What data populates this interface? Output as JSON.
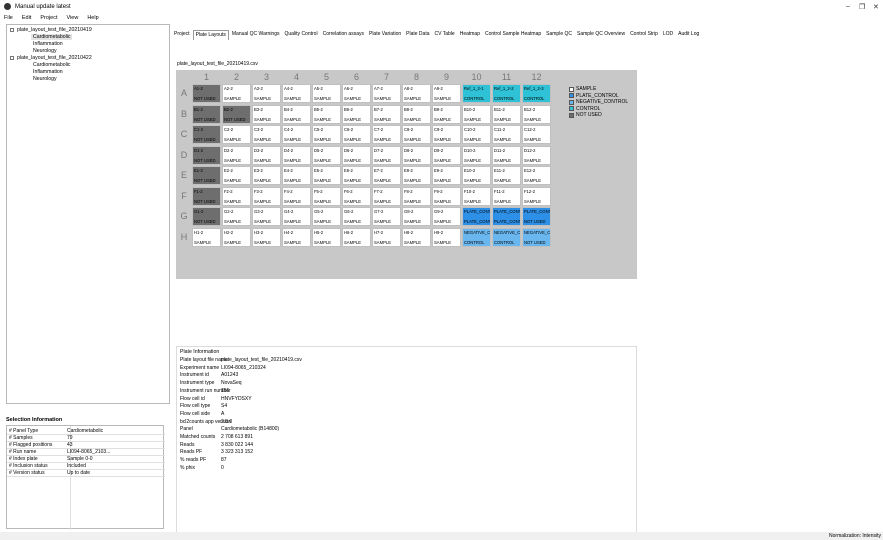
{
  "window": {
    "title": "Manual update latest",
    "minimize": "–",
    "maximize": "❐",
    "close": "✕"
  },
  "menu": [
    "File",
    "Edit",
    "Project",
    "View",
    "Help"
  ],
  "tree": [
    {
      "label": "plate_layout_test_file_20210419",
      "children": [
        "Cardiometabolic",
        "Inflammation",
        "Neurology"
      ]
    },
    {
      "label": "plate_layout_test_file_20210422",
      "children": [
        "Cardiometabolic",
        "Inflammation",
        "Neurology"
      ]
    }
  ],
  "selection": {
    "header": "Selection Information",
    "rows": [
      {
        "k": "# Panel Type",
        "v": "Cardiometabolic"
      },
      {
        "k": "# Samples",
        "v": "79"
      },
      {
        "k": "# Flagged positions",
        "v": "43"
      },
      {
        "k": "# Run name",
        "v": "LI094-8065_2103..."
      },
      {
        "k": "# Index plate",
        "v": "Sample 0-0"
      },
      {
        "k": "# Inclusion status",
        "v": "Included"
      },
      {
        "k": "# Version status",
        "v": "Up to date"
      }
    ]
  },
  "tabs": [
    "Project",
    "Plate Layouts",
    "Manual QC Warnings",
    "Quality Control",
    "Correlation assays",
    "Plate Variation",
    "Plate Data",
    "CV Table",
    "Heatmap",
    "Control Sample Heatmap",
    "Sample QC",
    "Sample QC Overview",
    "Control Strip",
    "LOD",
    "Audit Log"
  ],
  "active_tab": "Plate Layouts",
  "file_label": "plate_layout_test_file_20210419.csv",
  "plate": {
    "cols": [
      "1",
      "2",
      "3",
      "4",
      "5",
      "6",
      "7",
      "8",
      "9",
      "10",
      "11",
      "12"
    ],
    "rows": [
      "A",
      "B",
      "C",
      "D",
      "E",
      "F",
      "G",
      "H"
    ],
    "wells": [
      [
        [
          "A1-2",
          "NOT USED",
          "nu"
        ],
        [
          "A2-2",
          "SAMPLE",
          ""
        ],
        [
          "A3-2",
          "SAMPLE",
          ""
        ],
        [
          "A4-2",
          "SAMPLE",
          ""
        ],
        [
          "A5-2",
          "SAMPLE",
          ""
        ],
        [
          "A6-2",
          "SAMPLE",
          ""
        ],
        [
          "A7-2",
          "SAMPLE",
          ""
        ],
        [
          "A8-2",
          "SAMPLE",
          ""
        ],
        [
          "A9-2",
          "SAMPLE",
          ""
        ],
        [
          "Ref_1_2-1",
          "CONTROL",
          "pc"
        ],
        [
          "Ref_1_2-2",
          "CONTROL",
          "pc"
        ],
        [
          "Ref_1_2-3",
          "CONTROL",
          "pc"
        ]
      ],
      [
        [
          "B1-2",
          "NOT USED",
          "nu"
        ],
        [
          "B2-2",
          "NOT USED",
          "nu"
        ],
        [
          "B3-2",
          "SAMPLE",
          ""
        ],
        [
          "B4-2",
          "SAMPLE",
          ""
        ],
        [
          "B5-2",
          "SAMPLE",
          ""
        ],
        [
          "B6-2",
          "SAMPLE",
          ""
        ],
        [
          "B7-2",
          "SAMPLE",
          ""
        ],
        [
          "B8-2",
          "SAMPLE",
          ""
        ],
        [
          "B9-2",
          "SAMPLE",
          ""
        ],
        [
          "B10-2",
          "SAMPLE",
          ""
        ],
        [
          "B11-2",
          "SAMPLE",
          ""
        ],
        [
          "B12-2",
          "SAMPLE",
          ""
        ]
      ],
      [
        [
          "C1-2",
          "NOT USED",
          "nu"
        ],
        [
          "C2-2",
          "SAMPLE",
          ""
        ],
        [
          "C3-2",
          "SAMPLE",
          ""
        ],
        [
          "C4-2",
          "SAMPLE",
          ""
        ],
        [
          "C5-2",
          "SAMPLE",
          ""
        ],
        [
          "C6-2",
          "SAMPLE",
          ""
        ],
        [
          "C7-2",
          "SAMPLE",
          ""
        ],
        [
          "C8-2",
          "SAMPLE",
          ""
        ],
        [
          "C9-2",
          "SAMPLE",
          ""
        ],
        [
          "C10-2",
          "SAMPLE",
          ""
        ],
        [
          "C11-2",
          "SAMPLE",
          ""
        ],
        [
          "C12-2",
          "SAMPLE",
          ""
        ]
      ],
      [
        [
          "D1-2",
          "NOT USED",
          "nu"
        ],
        [
          "D2-2",
          "SAMPLE",
          ""
        ],
        [
          "D3-2",
          "SAMPLE",
          ""
        ],
        [
          "D4-2",
          "SAMPLE",
          ""
        ],
        [
          "D5-2",
          "SAMPLE",
          ""
        ],
        [
          "D6-2",
          "SAMPLE",
          ""
        ],
        [
          "D7-2",
          "SAMPLE",
          ""
        ],
        [
          "D8-2",
          "SAMPLE",
          ""
        ],
        [
          "D9-2",
          "SAMPLE",
          ""
        ],
        [
          "D10-2",
          "SAMPLE",
          ""
        ],
        [
          "D11-2",
          "SAMPLE",
          ""
        ],
        [
          "D12-2",
          "SAMPLE",
          ""
        ]
      ],
      [
        [
          "E1-2",
          "NOT USED",
          "nu"
        ],
        [
          "E2-2",
          "SAMPLE",
          ""
        ],
        [
          "E3-2",
          "SAMPLE",
          ""
        ],
        [
          "E4-2",
          "SAMPLE",
          ""
        ],
        [
          "E5-2",
          "SAMPLE",
          ""
        ],
        [
          "E6-2",
          "SAMPLE",
          ""
        ],
        [
          "E7-2",
          "SAMPLE",
          ""
        ],
        [
          "E8-2",
          "SAMPLE",
          ""
        ],
        [
          "E9-2",
          "SAMPLE",
          ""
        ],
        [
          "E10-2",
          "SAMPLE",
          ""
        ],
        [
          "E11-2",
          "SAMPLE",
          ""
        ],
        [
          "E12-2",
          "SAMPLE",
          ""
        ]
      ],
      [
        [
          "F1-2",
          "NOT USED",
          "nu"
        ],
        [
          "F2-2",
          "SAMPLE",
          ""
        ],
        [
          "F3-2",
          "SAMPLE",
          ""
        ],
        [
          "F4-2",
          "SAMPLE",
          ""
        ],
        [
          "F5-2",
          "SAMPLE",
          ""
        ],
        [
          "F6-2",
          "SAMPLE",
          ""
        ],
        [
          "F7-2",
          "SAMPLE",
          ""
        ],
        [
          "F8-2",
          "SAMPLE",
          ""
        ],
        [
          "F9-2",
          "SAMPLE",
          ""
        ],
        [
          "F10-2",
          "SAMPLE",
          ""
        ],
        [
          "F11-2",
          "SAMPLE",
          ""
        ],
        [
          "F12-2",
          "SAMPLE",
          ""
        ]
      ],
      [
        [
          "G1-2",
          "NOT USED",
          "nu"
        ],
        [
          "G2-2",
          "SAMPLE",
          ""
        ],
        [
          "G3-2",
          "SAMPLE",
          ""
        ],
        [
          "G4-2",
          "SAMPLE",
          ""
        ],
        [
          "G5-2",
          "SAMPLE",
          ""
        ],
        [
          "G6-2",
          "SAMPLE",
          ""
        ],
        [
          "G7-2",
          "SAMPLE",
          ""
        ],
        [
          "G8-2",
          "SAMPLE",
          ""
        ],
        [
          "G9-2",
          "SAMPLE",
          ""
        ],
        [
          "PLATE_CONTROL",
          "PLATE_CONTROL",
          "pc2"
        ],
        [
          "PLATE_CONTROL",
          "PLATE_CONTROL",
          "pc2"
        ],
        [
          "PLATE_CONTROL",
          "NOT USED",
          "pc2"
        ]
      ],
      [
        [
          "H1-2",
          "SAMPLE",
          ""
        ],
        [
          "H2-2",
          "SAMPLE",
          ""
        ],
        [
          "H3-2",
          "SAMPLE",
          ""
        ],
        [
          "H4-2",
          "SAMPLE",
          ""
        ],
        [
          "H5-2",
          "SAMPLE",
          ""
        ],
        [
          "H6-2",
          "SAMPLE",
          ""
        ],
        [
          "H7-2",
          "SAMPLE",
          ""
        ],
        [
          "H8-2",
          "SAMPLE",
          ""
        ],
        [
          "H9-2",
          "SAMPLE",
          ""
        ],
        [
          "NEGATIVE_CONTROL",
          "CONTROL",
          "nc"
        ],
        [
          "NEGATIVE_CONTROL",
          "CONTROL",
          "nc"
        ],
        [
          "NEGATIVE_CONTROL",
          "NOT USED",
          "nc"
        ]
      ]
    ]
  },
  "legend": [
    {
      "label": "SAMPLE",
      "color": "#ffffff"
    },
    {
      "label": "PLATE_CONTROL",
      "color": "#2e8fe6"
    },
    {
      "label": "NEGATIVE_CONTROL",
      "color": "#6ab7f0"
    },
    {
      "label": "CONTROL",
      "color": "#2fc2d6"
    },
    {
      "label": "NOT USED",
      "color": "#6e6e6e"
    }
  ],
  "info": {
    "header": "Plate Information",
    "rows": [
      {
        "k": "Plate layout file name",
        "v": "plate_layout_test_file_20210419.csv"
      },
      {
        "k": "Experiment name",
        "v": "LI094-8065_210324"
      },
      {
        "k": "Instrument id",
        "v": "A01243"
      },
      {
        "k": "Instrument type",
        "v": "NovaSeq"
      },
      {
        "k": "Instrument run number",
        "v": "166"
      },
      {
        "k": "Flow cell id",
        "v": "HNVFYDSXY"
      },
      {
        "k": "Flow cell type",
        "v": "S4"
      },
      {
        "k": "Flow cell side",
        "v": "A"
      },
      {
        "k": "bcl2counts app version",
        "v": "2.0.0"
      },
      {
        "k": "Panel",
        "v": "Cardiometabolic (B14800)"
      },
      {
        "k": "Matched counts",
        "v": "2 708 613 891"
      },
      {
        "k": "Reads",
        "v": "3 830 022 144"
      },
      {
        "k": "Reads PF",
        "v": "3 323 313 152"
      },
      {
        "k": "% reads PF",
        "v": "87"
      },
      {
        "k": "% phix",
        "v": "0"
      }
    ]
  },
  "status": "Normalization: Intensity"
}
